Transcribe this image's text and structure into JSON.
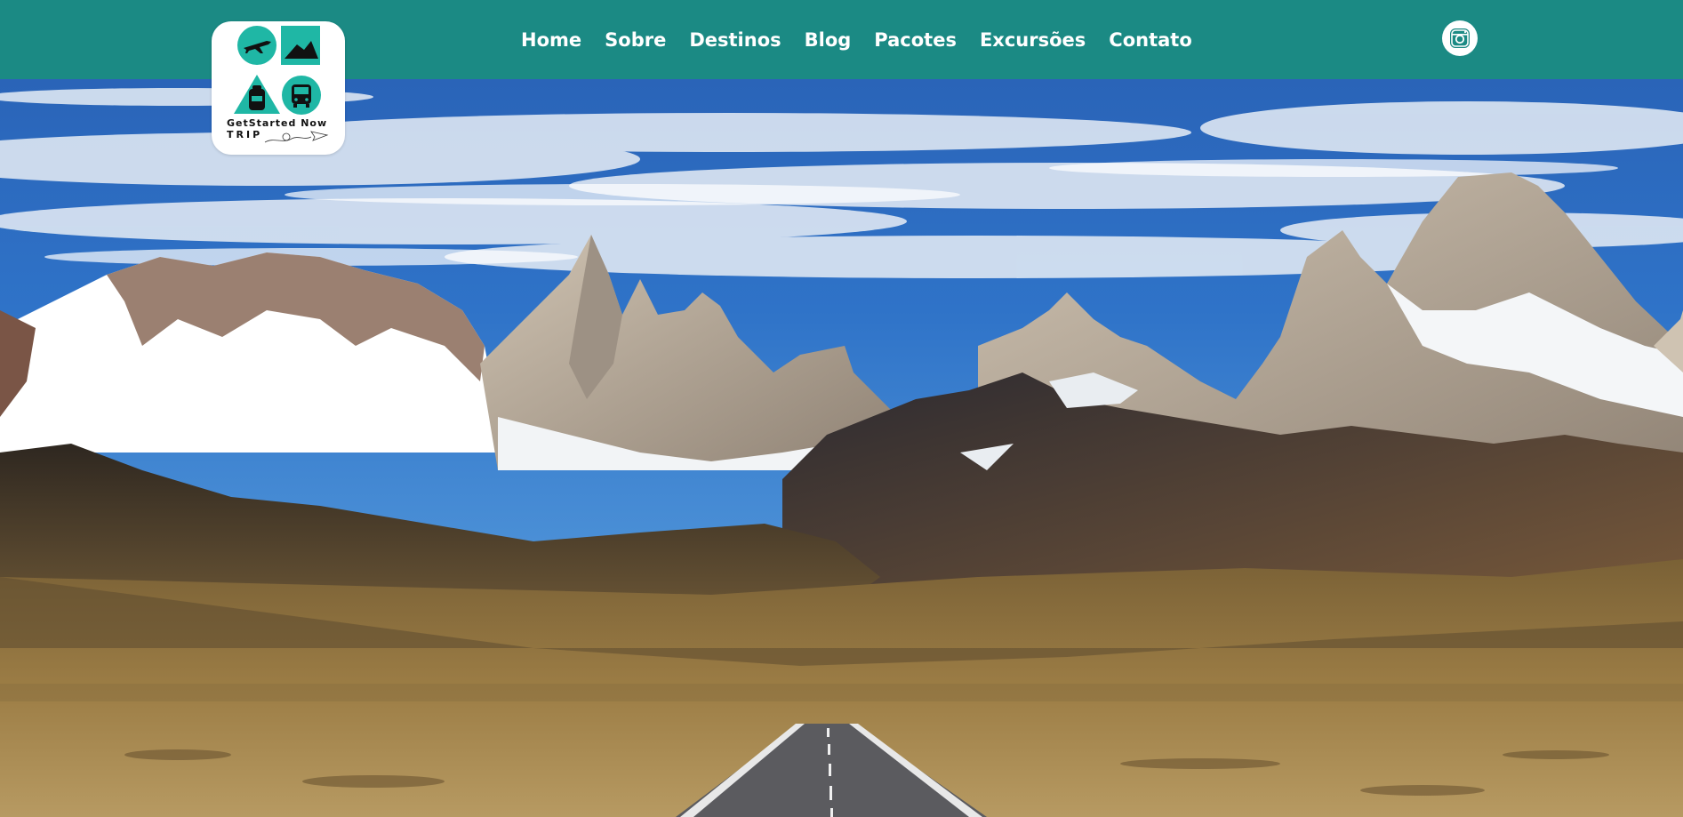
{
  "brand": {
    "line1": "GetStarted Now",
    "line2": "TRIP",
    "accent_color": "#1fb7a5",
    "icons": [
      "airplane-icon",
      "mountain-icon",
      "backpack-icon",
      "bus-icon"
    ]
  },
  "nav": {
    "items": [
      {
        "label": "Home"
      },
      {
        "label": "Sobre"
      },
      {
        "label": "Destinos"
      },
      {
        "label": "Blog"
      },
      {
        "label": "Pacotes"
      },
      {
        "label": "Excursões"
      },
      {
        "label": "Contato"
      }
    ],
    "background_color": "#1b8a84",
    "text_color": "#ffffff"
  },
  "social": {
    "icon": "instagram-icon"
  },
  "hero": {
    "image": "mountain-road-landscape"
  }
}
